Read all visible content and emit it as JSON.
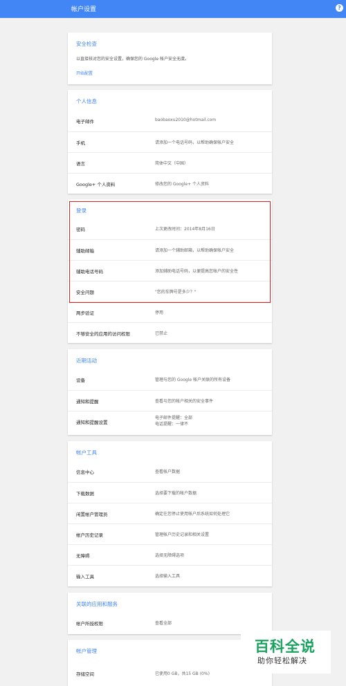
{
  "header": {
    "title": "帐户设置",
    "help_icon": "?",
    "bar_color": "#4285f4"
  },
  "security_check": {
    "title": "安全检查",
    "description": "以直接核对您的安全设置，确保您的 Google 帐户安全无虞。",
    "link": "开始配置"
  },
  "personal_info": {
    "title": "个人信息",
    "rows": [
      {
        "label": "电子邮件",
        "value": "baobaoxu2010@hotmail.com"
      },
      {
        "label": "手机",
        "value": "请添加一个电话号码，以帮助确保帐户安全"
      },
      {
        "label": "语言",
        "value": "简体中文（中国）"
      },
      {
        "label": "Google+ 个人资料",
        "value": "修改您的 Google+ 个人资料"
      }
    ]
  },
  "signin": {
    "title": "登录",
    "rows": [
      {
        "label": "密码",
        "value": "上次更改时间：2014年8月16日"
      },
      {
        "label": "辅助邮箱",
        "value": "请添加一个辅助邮箱，以帮助确保帐户安全"
      },
      {
        "label": "辅助电话号码",
        "value": "添加辅助电话号码，以便提高您帐户的安全性"
      },
      {
        "label": "安全问题",
        "value": "\"您的车牌号是多少？\""
      },
      {
        "label": "两步验证",
        "value": "停用"
      },
      {
        "label": "不够安全的应用的访问权限",
        "value": "已禁止"
      }
    ]
  },
  "recent_activity": {
    "title": "近期活动",
    "rows": [
      {
        "label": "设备",
        "value": "管理与您的 Google 帐户关联的所有设备"
      },
      {
        "label": "通知和提醒",
        "value": "查看与您的帐户相关的安全事件"
      },
      {
        "label": "通知和提醒设置",
        "value": "电子邮件提醒：全部",
        "value2": "电话提醒：一律不"
      }
    ]
  },
  "account_tools": {
    "title": "帐户工具",
    "rows": [
      {
        "label": "信息中心",
        "value": "查看帐户数据"
      },
      {
        "label": "下载数据",
        "value": "选择要下载的帐户数据"
      },
      {
        "label": "闲置帐户管理员",
        "value": "确定在您停止使用帐户后系统如何处理它"
      },
      {
        "label": "帐户历史记录",
        "value": "管理帐户历史记录和相关设置"
      },
      {
        "label": "无障碍",
        "value": "选择无障碍选项"
      },
      {
        "label": "输入工具",
        "value": "选择输入工具"
      }
    ]
  },
  "connected_apps": {
    "title": "关联的应用和服务",
    "rows": [
      {
        "label": "帐户所授权限",
        "value": "查看全部"
      }
    ]
  },
  "account_management": {
    "title": "帐户管理",
    "rows": [
      {
        "label": "存储空间",
        "value": "已使用0 GB，共15 GB (0%)"
      }
    ]
  },
  "watermark": {
    "logo": "百科全说",
    "sub": "助你轻松解决"
  },
  "colors": {
    "accent": "#4285f4",
    "highlight": "#e11d1d",
    "watermark_green": "#1aa260"
  }
}
